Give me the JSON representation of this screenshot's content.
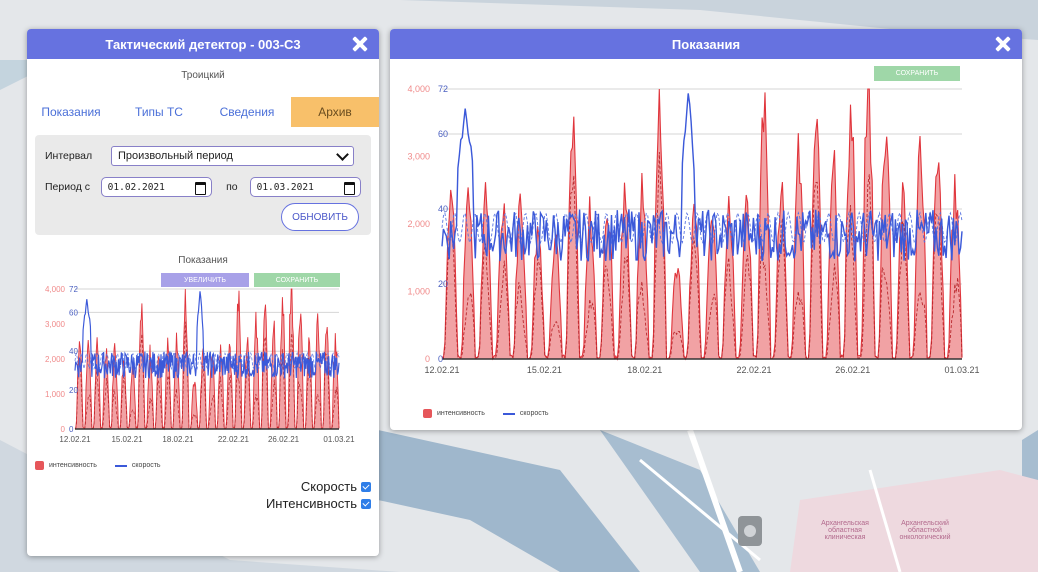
{
  "map": {
    "labels": [
      "Архангельская областная клиническая",
      "Архангельский областной онкологический"
    ]
  },
  "left_panel": {
    "title": "Тактический детектор - 003-С3",
    "subtitle": "Троицкий",
    "tabs": [
      {
        "label": "Показания"
      },
      {
        "label": "Типы ТС"
      },
      {
        "label": "Сведения"
      },
      {
        "label": "Архив"
      }
    ],
    "filters": {
      "interval_label": "Интервал",
      "interval_value": "Произвольный период",
      "period_from_label": "Период с",
      "period_from": "01.02.2021",
      "period_to_label": "по",
      "period_to": "01.03.2021",
      "refresh_label": "ОБНОВИТЬ"
    },
    "chart_title": "Показания",
    "zoom_label": "УВЕЛИЧИТЬ",
    "save_label": "СОХРАНИТЬ",
    "legend": {
      "intensity": "интенсивность",
      "speed": "скорость"
    },
    "checks": {
      "speed": "Скорость",
      "intensity": "Интенсивность"
    }
  },
  "right_panel": {
    "title": "Показания",
    "save_label": "СОХРАНИТЬ",
    "legend": {
      "intensity": "интенсивность",
      "speed": "скорость"
    }
  },
  "colors": {
    "header": "#6672e0",
    "active_tab": "#f8c06a",
    "intensity": "#e6565a",
    "speed": "#3b59d9"
  },
  "chart_data": {
    "type": "line",
    "x_ticks": [
      "12.02.21",
      "15.02.21",
      "18.02.21",
      "22.02.21",
      "26.02.21",
      "01.03.21"
    ],
    "y_left_ticks": [
      "0",
      "1,000",
      "2,000",
      "3,000",
      "4,000"
    ],
    "y_right_ticks": [
      "0",
      "20",
      "40",
      "60",
      "72"
    ],
    "y_left_range": [
      0,
      4000
    ],
    "y_right_range": [
      0,
      72
    ],
    "series": [
      {
        "name": "интенсивность",
        "axis": "left",
        "color": "#e6565a",
        "kind": "area",
        "daily_peaks": [
          2400,
          2500,
          2300,
          2200,
          2300,
          1900,
          1800,
          3200,
          2100,
          2200,
          2300,
          2400,
          3600,
          1400,
          2200,
          2300,
          2200,
          2100,
          3900,
          2600,
          2900,
          3300,
          3000,
          3600,
          3900,
          3400,
          2300,
          3100,
          2700,
          2400
        ]
      },
      {
        "name": "скорость",
        "axis": "right",
        "color": "#3b59d9",
        "kind": "line",
        "typical": 33,
        "peaks": [
          {
            "x": "13.02.21",
            "value": 67
          },
          {
            "x": "26.02.21",
            "value": 72
          }
        ]
      }
    ],
    "grid": true,
    "legend_position": "bottom-left"
  }
}
